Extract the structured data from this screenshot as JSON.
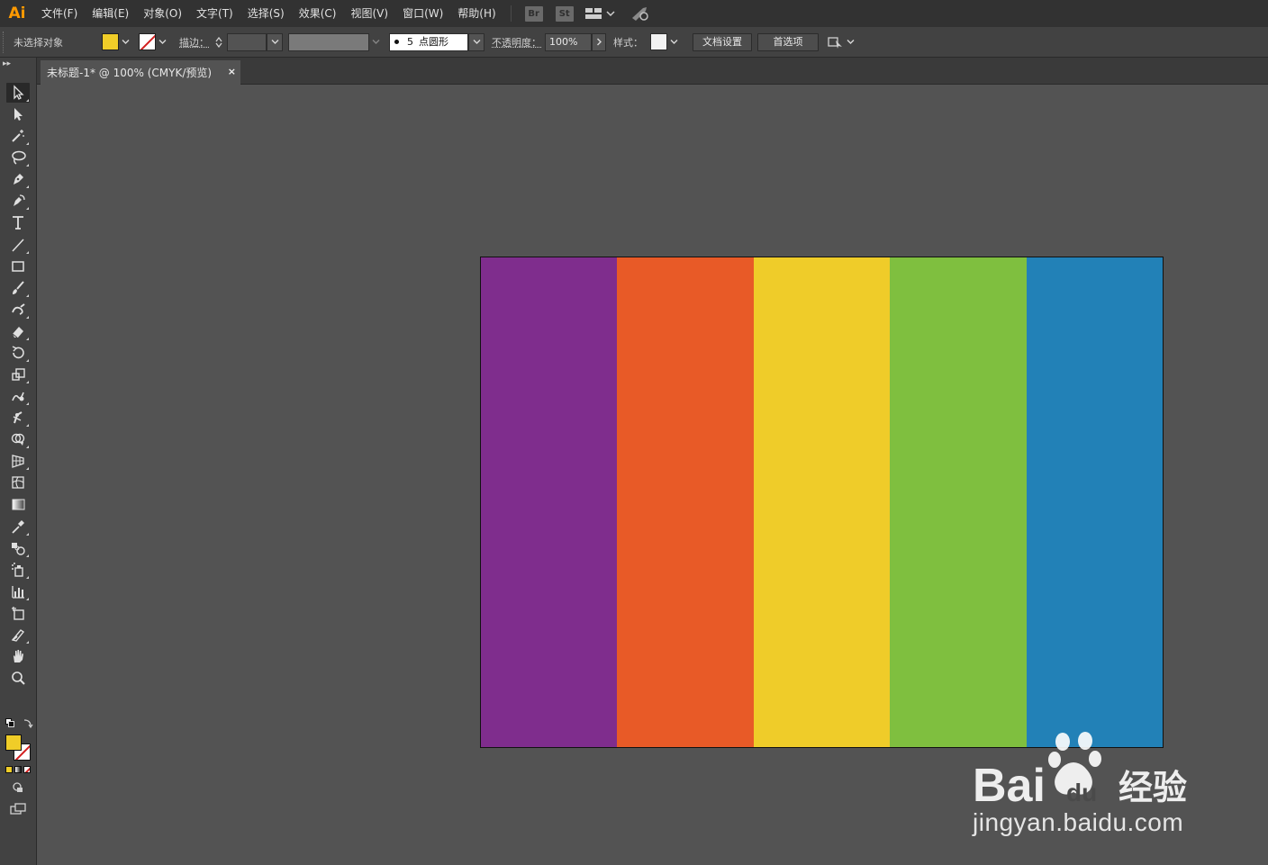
{
  "app": {
    "logo": "Ai"
  },
  "menu": {
    "items": [
      {
        "label": "文件(F)"
      },
      {
        "label": "编辑(E)"
      },
      {
        "label": "对象(O)"
      },
      {
        "label": "文字(T)"
      },
      {
        "label": "选择(S)"
      },
      {
        "label": "效果(C)"
      },
      {
        "label": "视图(V)"
      },
      {
        "label": "窗口(W)"
      },
      {
        "label": "帮助(H)"
      }
    ],
    "bridge_label": "Br",
    "stock_label": "St"
  },
  "control": {
    "selection_status": "未选择对象",
    "fill_color": "#f0cd28",
    "stroke_label": "描边：",
    "brush_size": "5",
    "brush_name": "点圆形",
    "opacity_label": "不透明度：",
    "opacity_value": "100%",
    "style_label": "样式：",
    "doc_setup_label": "文档设置",
    "preferences_label": "首选项"
  },
  "document": {
    "tab_title": "未标题-1* @ 100% (CMYK/预览)",
    "close_glyph": "×"
  },
  "tools": [
    {
      "name": "selection-tool-icon",
      "active": true
    },
    {
      "name": "direct-selection-tool-icon"
    },
    {
      "name": "magic-wand-tool-icon"
    },
    {
      "name": "lasso-tool-icon"
    },
    {
      "name": "pen-tool-icon"
    },
    {
      "name": "curvature-tool-icon"
    },
    {
      "name": "type-tool-icon"
    },
    {
      "name": "line-segment-tool-icon"
    },
    {
      "name": "rectangle-tool-icon"
    },
    {
      "name": "paintbrush-tool-icon"
    },
    {
      "name": "shaper-tool-icon"
    },
    {
      "name": "eraser-tool-icon"
    },
    {
      "name": "rotate-tool-icon"
    },
    {
      "name": "scale-tool-icon"
    },
    {
      "name": "warp-tool-icon"
    },
    {
      "name": "puppet-warp-tool-icon"
    },
    {
      "name": "shape-builder-tool-icon"
    },
    {
      "name": "perspective-grid-tool-icon"
    },
    {
      "name": "mesh-tool-icon"
    },
    {
      "name": "gradient-tool-icon"
    },
    {
      "name": "eyedropper-tool-icon"
    },
    {
      "name": "blend-tool-icon"
    },
    {
      "name": "symbol-sprayer-tool-icon"
    },
    {
      "name": "column-graph-tool-icon"
    },
    {
      "name": "artboard-tool-icon"
    },
    {
      "name": "slice-tool-icon"
    },
    {
      "name": "hand-tool-icon"
    },
    {
      "name": "zoom-tool-icon"
    }
  ],
  "artboard": {
    "stripes": [
      {
        "color": "#7f2d8d"
      },
      {
        "color": "#e85a27"
      },
      {
        "color": "#efcc29"
      },
      {
        "color": "#7fbf3f"
      },
      {
        "color": "#2281b7"
      }
    ]
  },
  "watermark": {
    "logo_text": "Bai du 经验",
    "url": "jingyan.baidu.com"
  }
}
